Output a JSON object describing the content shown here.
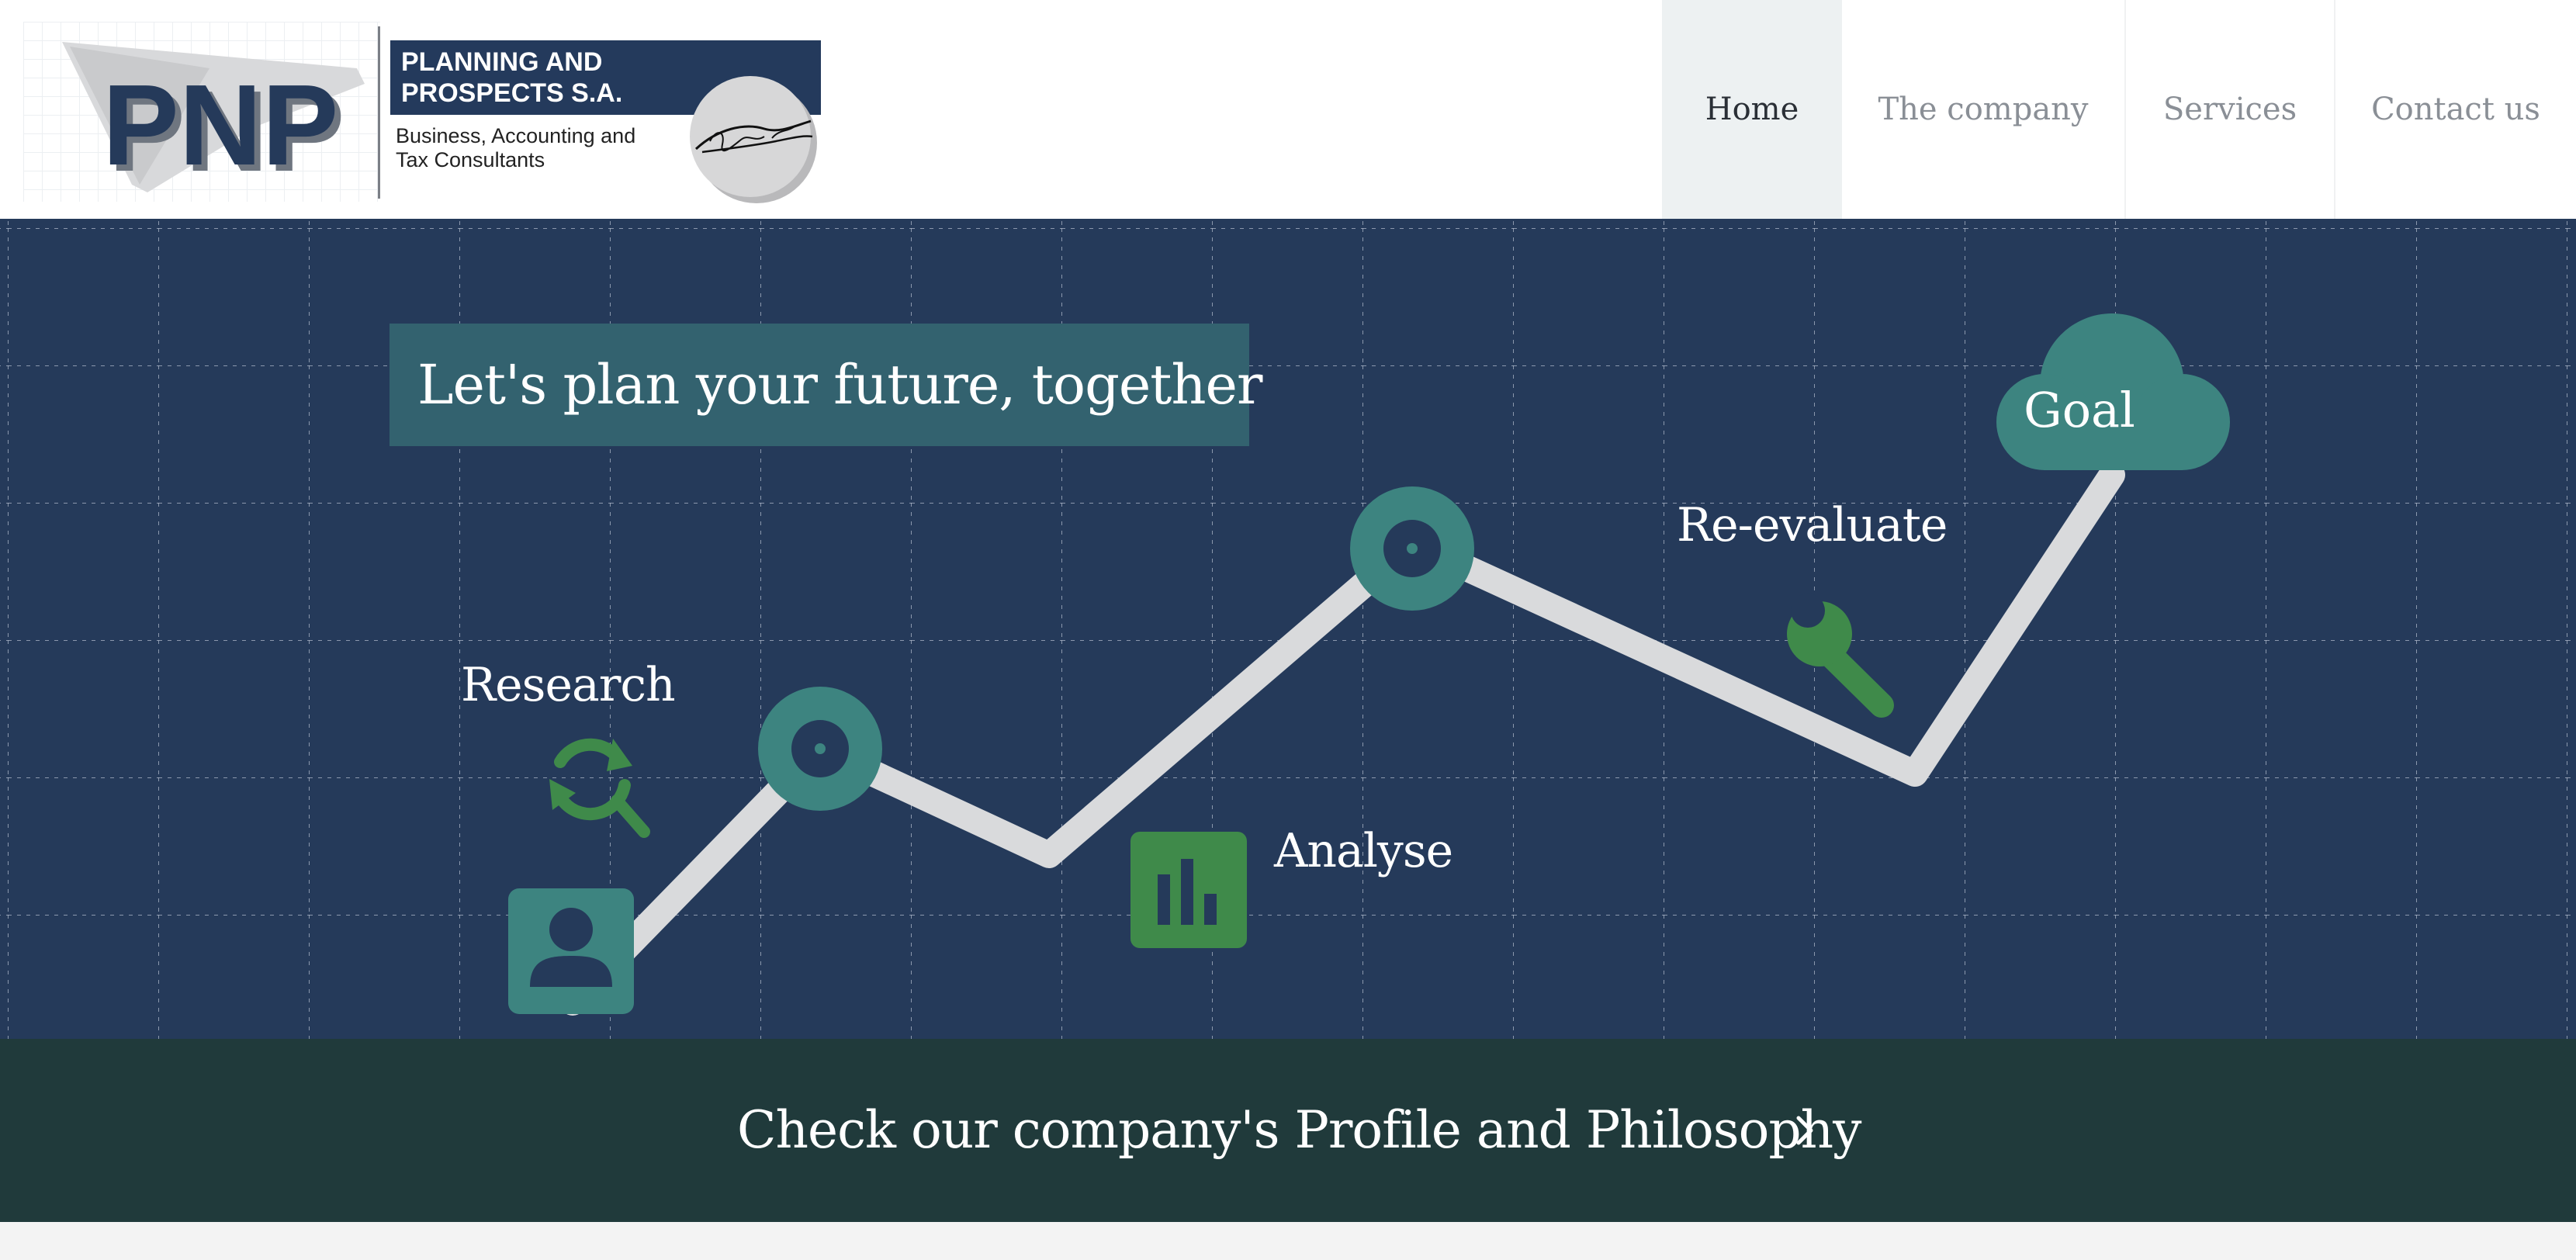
{
  "logo": {
    "mark_text": "PNP",
    "title_lines": [
      "PLANNING AND",
      "PROSPECTS S.A."
    ],
    "subtitle_lines": [
      "Business, Accounting and",
      "Tax Consultants"
    ]
  },
  "nav": {
    "items": [
      {
        "label": "Home",
        "active": true
      },
      {
        "label": "The company",
        "active": false
      },
      {
        "label": "Services",
        "active": false
      },
      {
        "label": "Contact us",
        "active": false
      }
    ]
  },
  "hero": {
    "tagline": "Let's plan your future, together",
    "steps": {
      "research": "Research",
      "analyse": "Analyse",
      "re_evaluate": "Re-evaluate",
      "goal": "Goal"
    },
    "icons": [
      "user-icon",
      "refresh-search-icon",
      "bar-chart-icon",
      "wrench-icon",
      "target-icon",
      "cloud-icon"
    ]
  },
  "cta": {
    "label": "Check our company's Profile and Philosophy",
    "icon": "chevron-right-icon"
  },
  "colors": {
    "navy": "#253a5a",
    "teal": "#3d8480",
    "green": "#3f8a4a",
    "cta_bg": "#203a3b",
    "tagline_bg": "#33626f",
    "path": "#d9dadc"
  }
}
